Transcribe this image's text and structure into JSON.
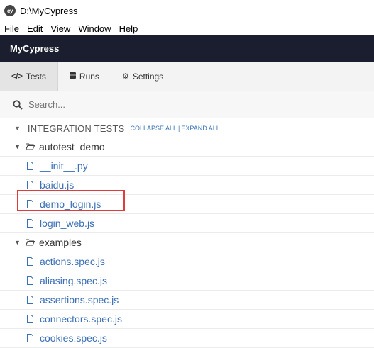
{
  "window": {
    "title": "D:\\MyCypress",
    "logo_text": "cy"
  },
  "menubar": {
    "items": [
      "File",
      "Edit",
      "View",
      "Window",
      "Help"
    ]
  },
  "header": {
    "project_name": "MyCypress"
  },
  "nav": {
    "tabs": [
      {
        "label": "Tests",
        "icon": "code-icon",
        "active": true
      },
      {
        "label": "Runs",
        "icon": "database-icon",
        "active": false
      },
      {
        "label": "Settings",
        "icon": "gear-icon",
        "active": false
      }
    ]
  },
  "search": {
    "placeholder": "Search...",
    "value": ""
  },
  "section": {
    "title": "INTEGRATION TESTS",
    "collapse_all": "COLLAPSE ALL",
    "separator": "|",
    "expand_all": "EXPAND ALL"
  },
  "tree": {
    "folder1": "autotest_demo",
    "files1": [
      "__init__.py",
      "baidu.js",
      "demo_login.js",
      "login_web.js"
    ],
    "folder2": "examples",
    "files2": [
      "actions.spec.js",
      "aliasing.spec.js",
      "assertions.spec.js",
      "connectors.spec.js",
      "cookies.spec.js"
    ]
  },
  "colors": {
    "header_bg": "#1b1e2e",
    "file_link": "#3b6fb6",
    "highlight_border": "#e03c3c",
    "action_link": "#3b74b8"
  }
}
